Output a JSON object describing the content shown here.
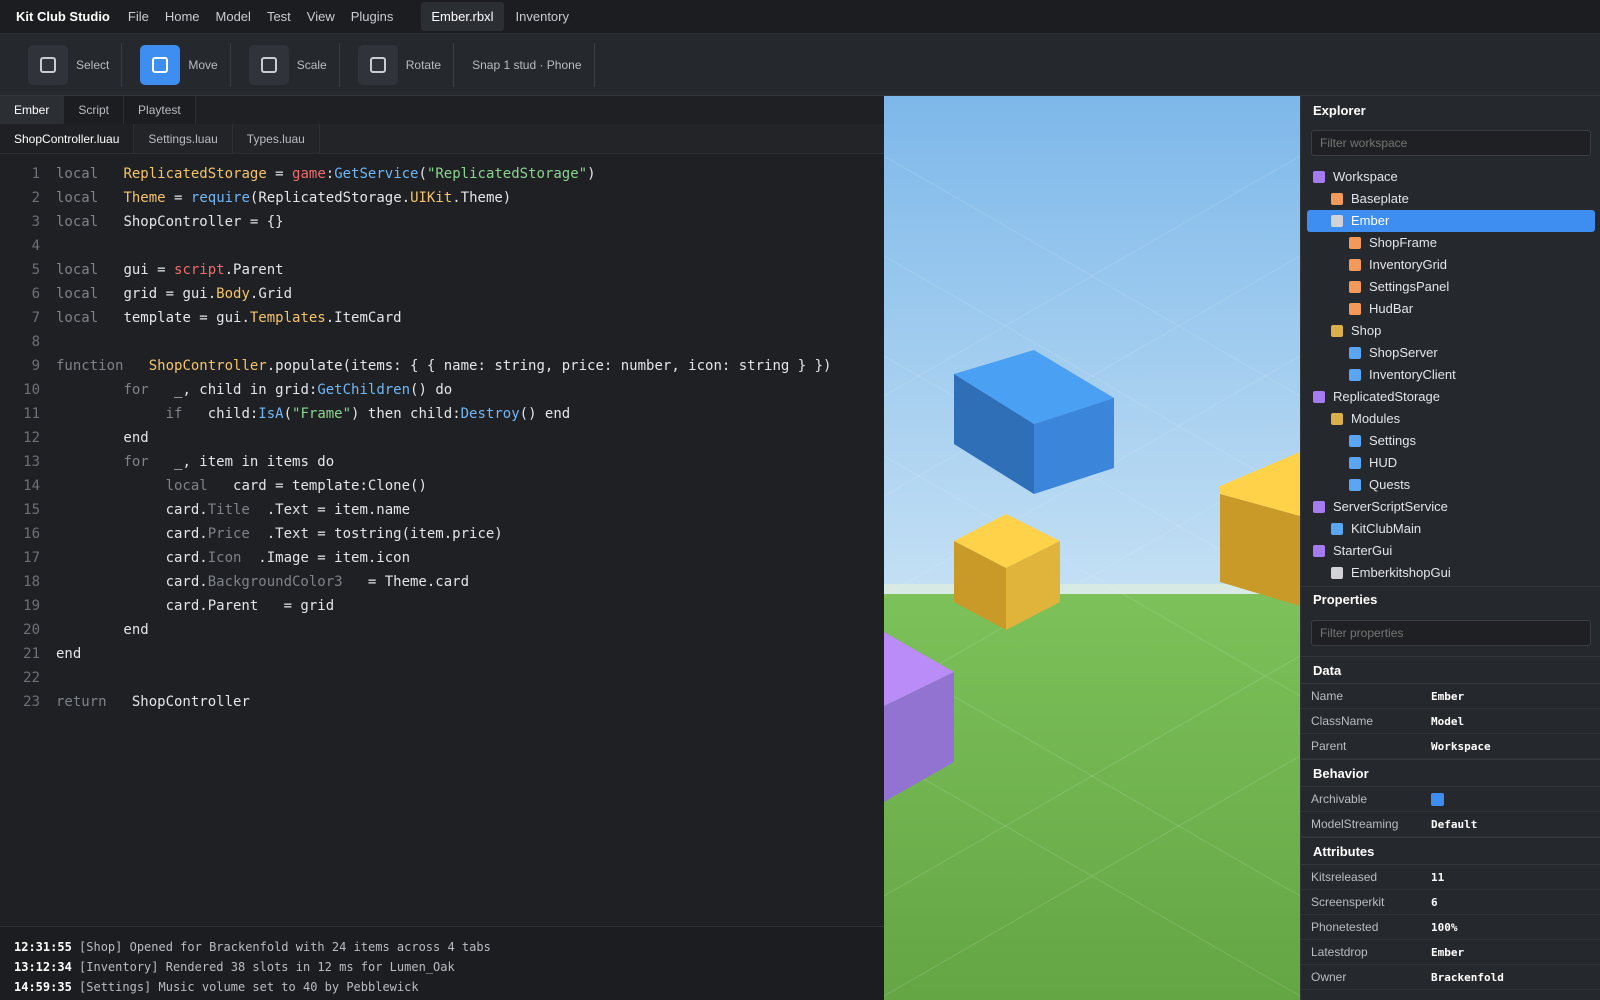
{
  "app": {
    "title": "Kit Club Studio"
  },
  "menu": [
    "File",
    "Home",
    "Model",
    "Test",
    "View",
    "Plugins"
  ],
  "doc_tabs": [
    "Ember.rbxl",
    "Inventory"
  ],
  "toolbar": {
    "tools": [
      {
        "label": "Select",
        "icon": "select-icon",
        "active": false
      },
      {
        "label": "Move",
        "icon": "move-icon",
        "active": true
      },
      {
        "label": "Scale",
        "icon": "scale-icon",
        "active": false
      },
      {
        "label": "Rotate",
        "icon": "rotate-icon",
        "active": false
      }
    ],
    "snap": "Snap 1 stud · Phone"
  },
  "editor": {
    "panel_tabs": [
      "Ember",
      "Script",
      "Playtest"
    ],
    "file_tabs": [
      "ShopController.luau",
      "Settings.luau",
      "Types.luau"
    ],
    "line_numbers": [
      "1",
      "2",
      "3",
      "4",
      "5",
      "6",
      "7",
      "8",
      "9",
      "10",
      "11",
      "12",
      "13",
      "14",
      "15",
      "16",
      "17",
      "18",
      "19",
      "20",
      "21",
      "22",
      "23"
    ],
    "code": [
      "local   ReplicatedStorage = game:GetService(\"ReplicatedStorage\")",
      "local   Theme = require(ReplicatedStorage.UIKit.Theme)",
      "local   ShopController = {}",
      "",
      "local   gui = script.Parent",
      "local   grid = gui.Body.Grid",
      "local   template = gui.Templates.ItemCard",
      "",
      "function   ShopController.populate(items: { { name: string, price: number, icon: string } })",
      "        for   _, child in grid:GetChildren() do",
      "             if   child:IsA(\"Frame\") then child:Destroy() end",
      "        end",
      "        for   _, item in items do",
      "             local   card = template:Clone()",
      "             card.Title  .Text = item.name",
      "             card.Price  .Text = tostring(item.price)",
      "             card.Icon  .Image = item.icon",
      "             card.BackgroundColor3   = Theme.card",
      "             card.Parent   = grid",
      "        end",
      "end",
      "",
      "return   ShopController"
    ]
  },
  "console": [
    {
      "time": "12:31:55",
      "text": " [Shop] Opened for Brackenfold with 24 items across 4 tabs"
    },
    {
      "time": "13:12:34",
      "text": " [Inventory] Rendered 38 slots in 12 ms for Lumen_Oak"
    },
    {
      "time": "14:59:35",
      "text": " [Settings] Music volume set to 40 by Pebblewick"
    }
  ],
  "explorer": {
    "title": "Explorer",
    "filter_placeholder": "Filter workspace",
    "items": [
      {
        "label": "Workspace",
        "depth": 0,
        "color": "#a77bf0",
        "selected": false
      },
      {
        "label": "Baseplate",
        "depth": 1,
        "color": "#f39a5a",
        "selected": false
      },
      {
        "label": "Ember",
        "depth": 1,
        "color": "#d0d2d6",
        "selected": true
      },
      {
        "label": "ShopFrame",
        "depth": 2,
        "color": "#f39a5a",
        "selected": false
      },
      {
        "label": "InventoryGrid",
        "depth": 2,
        "color": "#f39a5a",
        "selected": false
      },
      {
        "label": "SettingsPanel",
        "depth": 2,
        "color": "#f39a5a",
        "selected": false
      },
      {
        "label": "HudBar",
        "depth": 2,
        "color": "#f39a5a",
        "selected": false
      },
      {
        "label": "Shop",
        "depth": 1,
        "color": "#d9b04a",
        "selected": false
      },
      {
        "label": "ShopServer",
        "depth": 2,
        "color": "#5aa6f3",
        "selected": false
      },
      {
        "label": "InventoryClient",
        "depth": 2,
        "color": "#5aa6f3",
        "selected": false
      },
      {
        "label": "ReplicatedStorage",
        "depth": 0,
        "color": "#a77bf0",
        "selected": false
      },
      {
        "label": "Modules",
        "depth": 1,
        "color": "#d9b04a",
        "selected": false
      },
      {
        "label": "Settings",
        "depth": 2,
        "color": "#5aa6f3",
        "selected": false
      },
      {
        "label": "HUD",
        "depth": 2,
        "color": "#5aa6f3",
        "selected": false
      },
      {
        "label": "Quests",
        "depth": 2,
        "color": "#5aa6f3",
        "selected": false
      },
      {
        "label": "ServerScriptService",
        "depth": 0,
        "color": "#a77bf0",
        "selected": false
      },
      {
        "label": "KitClubMain",
        "depth": 1,
        "color": "#5aa6f3",
        "selected": false
      },
      {
        "label": "StarterGui",
        "depth": 0,
        "color": "#a77bf0",
        "selected": false
      },
      {
        "label": "EmberkitshopGui",
        "depth": 1,
        "color": "#d0d2d6",
        "selected": false
      }
    ]
  },
  "properties": {
    "title": "Properties",
    "filter_placeholder": "Filter properties",
    "sections": [
      {
        "name": "Data",
        "rows": [
          {
            "name": "Name",
            "value": "Ember"
          },
          {
            "name": "ClassName",
            "value": "Model"
          },
          {
            "name": "Parent",
            "value": "Workspace"
          }
        ]
      },
      {
        "name": "Behavior",
        "rows": [
          {
            "name": "Archivable",
            "value": "",
            "checkbox": true
          },
          {
            "name": "ModelStreaming",
            "value": "Default"
          }
        ]
      },
      {
        "name": "Attributes",
        "rows": [
          {
            "name": "Kitsreleased",
            "value": "11"
          },
          {
            "name": "Screensperkit",
            "value": "6"
          },
          {
            "name": "Phonetested",
            "value": "100%"
          },
          {
            "name": "Latestdrop",
            "value": "Ember"
          },
          {
            "name": "Owner",
            "value": "Brackenfold"
          }
        ]
      }
    ]
  },
  "colors": {
    "accent": "#3d8ef0",
    "sky": "#8ec3ee",
    "ground": "#6fb24c"
  }
}
